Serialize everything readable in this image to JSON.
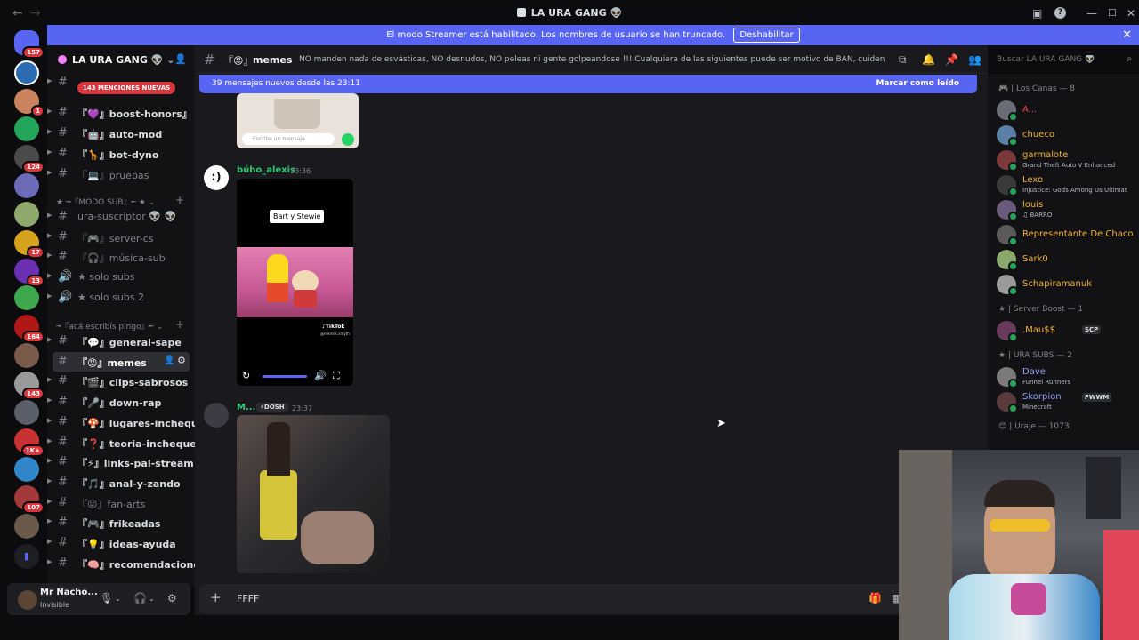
{
  "titlebar": {
    "title": "LA URA GANG 👽",
    "back_label": "←",
    "forward_label": "→"
  },
  "banner": {
    "text": "El modo Streamer está habilitado. Los nombres de usuario se han truncado.",
    "button": "Deshabilitar",
    "close": "✕"
  },
  "rail": {
    "badges": [
      "157",
      "1",
      "124",
      "17",
      "13",
      "164",
      "143",
      "1K+",
      "107"
    ]
  },
  "server": {
    "name": "LA URA GANG 👽",
    "mention_pill": "143 MENCIONES NUEVAS",
    "channels_top": [
      {
        "label": "『💜』boost-honors』",
        "muted": false
      },
      {
        "label": "『🤖』auto-mod",
        "muted": false
      },
      {
        "label": "『🦒』bot-dyno",
        "muted": false
      },
      {
        "label": "『💻』pruebas",
        "muted": true
      }
    ],
    "cat_sub": "★ ╼『MODO SUB』╾ ★",
    "channels_sub": [
      {
        "label": "ura-suscriptor 👽 👽",
        "muted": true
      },
      {
        "label": "『🎮』server-cs",
        "muted": true
      },
      {
        "label": "『🎧』música-sub",
        "muted": true
      },
      {
        "label": "★ solo subs",
        "muted": true
      },
      {
        "label": "★ solo subs 2",
        "muted": true
      }
    ],
    "cat_pingo": "╼『acá escribís pingo』╾",
    "channels_pingo": [
      {
        "label": "『💬』general-sape",
        "muted": false
      },
      {
        "label": "『😡』memes",
        "muted": false
      },
      {
        "label": "『🎬』clips-sabrosos",
        "muted": false
      },
      {
        "label": "『🎤』down-rap",
        "muted": false
      },
      {
        "label": "『🍄』lugares-inchequ...",
        "muted": false
      },
      {
        "label": "『❓』teoria-inchequea...",
        "muted": false
      },
      {
        "label": "『⚡』links-pal-stream",
        "muted": false
      },
      {
        "label": "『🎵』anal-y-zando",
        "muted": false
      },
      {
        "label": "『😛』fan-arts",
        "muted": true
      },
      {
        "label": "『🎮』frikeadas",
        "muted": false
      },
      {
        "label": "『💡』ideas-ayuda",
        "muted": false
      },
      {
        "label": "『🧠』recomendaciones",
        "muted": false
      }
    ]
  },
  "user": {
    "name": "Mr Nacho...",
    "status": "Invisible"
  },
  "channel": {
    "name": "memes",
    "emoji": "『😡』",
    "topic": "NO manden nada de esvásticas, NO desnudos, NO peleas ni gente golpeandose !!! Cualquiera de las siguientes puede ser motivo de BAN, cuiden el stream!"
  },
  "new_messages": {
    "text": "39 mensajes nuevos desde las 23:11",
    "action": "Marcar como leído"
  },
  "messages": [
    {
      "author": "búho_alexis",
      "time": "23:36",
      "color": "#2dc770",
      "video_caption": "Bart y Stewie",
      "tiktok_label": "TikTok",
      "tiktok_handle": "@memes.xmyth"
    },
    {
      "author": "M...",
      "tag": "DOSH",
      "time": "23:37",
      "color": "#2dc770"
    }
  ],
  "whatsapp_placeholder": "Escribe un mensaje",
  "composer": {
    "value": "FFFF"
  },
  "search": {
    "placeholder": "Buscar LA URA GANG 👽"
  },
  "members": {
    "groups": [
      {
        "header": "🎮 | Los Canas — 8",
        "items": [
          {
            "name": "A...",
            "activity": "",
            "color": "#f23f43"
          },
          {
            "name": "chueco",
            "activity": "",
            "color": "#f0b232"
          },
          {
            "name": "garmalote",
            "activity": "Grand Theft Auto V Enhanced",
            "color": "#f0b232"
          },
          {
            "name": "Lexo",
            "activity": "Injustice: Gods Among Us Ultimat",
            "color": "#f0b232"
          },
          {
            "name": "louis",
            "activity": "♫ BARRO",
            "color": "#f0b232"
          },
          {
            "name": "Representante De Chaco",
            "activity": "",
            "color": "#f0b232"
          },
          {
            "name": "Sark0",
            "activity": "",
            "color": "#f0b232"
          },
          {
            "name": "Schapiramanuk",
            "activity": "",
            "color": "#f0b232"
          }
        ]
      },
      {
        "header": "★ | Server Boost — 1",
        "items": [
          {
            "name": ".Mau$$",
            "activity": "",
            "color": "#f0b232",
            "tag": "SCP"
          }
        ]
      },
      {
        "header": "★ | URA SUBS — 2",
        "items": [
          {
            "name": "Dave",
            "activity": "Funnel Runners",
            "color": "#949cf7"
          },
          {
            "name": "Skorpion",
            "activity": "Minecraft",
            "color": "#949cf7",
            "tag": "FWWM"
          }
        ]
      },
      {
        "header": "😊 | Uraje — 1073",
        "items": []
      }
    ]
  }
}
